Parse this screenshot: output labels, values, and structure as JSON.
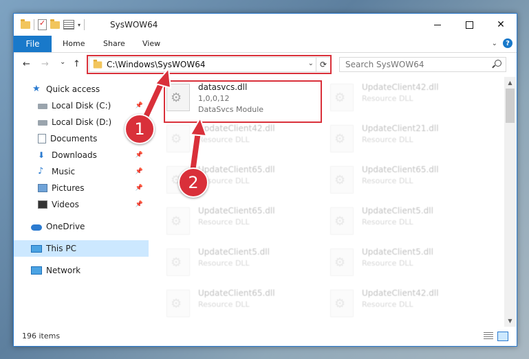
{
  "window": {
    "title": "SysWOW64",
    "controls": {
      "minimize": "",
      "maximize": "",
      "close": "✕"
    }
  },
  "ribbon": {
    "tabs": [
      "File",
      "Home",
      "Share",
      "View"
    ],
    "help": "?"
  },
  "navigation": {
    "back": "←",
    "forward": "→",
    "recent": "⌄",
    "up": "↑",
    "address": "C:\\Windows\\SysWOW64",
    "search_placeholder": "Search SysWOW64"
  },
  "sidebar": {
    "items": [
      {
        "label": "Quick access",
        "icon": "star-icon"
      },
      {
        "label": "Local Disk (C:)",
        "icon": "disk-icon",
        "pinned": true
      },
      {
        "label": "Local Disk (D:)",
        "icon": "disk-icon"
      },
      {
        "label": "Documents",
        "icon": "documents-icon",
        "pinned": true
      },
      {
        "label": "Downloads",
        "icon": "download-icon",
        "pinned": true
      },
      {
        "label": "Music",
        "icon": "music-icon",
        "pinned": true
      },
      {
        "label": "Pictures",
        "icon": "pictures-icon",
        "pinned": true
      },
      {
        "label": "Videos",
        "icon": "videos-icon",
        "pinned": true
      },
      {
        "label": "OneDrive",
        "icon": "cloud-icon"
      },
      {
        "label": "This PC",
        "icon": "computer-icon",
        "selected": true
      },
      {
        "label": "Network",
        "icon": "network-icon"
      }
    ]
  },
  "files": [
    {
      "name": "datasvcs.dll",
      "version": "1,0,0,12",
      "description": "DataSvcs Module",
      "highlighted": true
    },
    {
      "name": "UpdateClient42.dll",
      "description": "Resource DLL"
    },
    {
      "name": "UpdateClient42.dll",
      "description": "Resource DLL"
    },
    {
      "name": "UpdateClient21.dll",
      "description": "Resource DLL"
    },
    {
      "name": "UpdateClient65.dll",
      "description": "Resource DLL"
    },
    {
      "name": "UpdateClient65.dll",
      "description": "Resource DLL"
    },
    {
      "name": "UpdateClient65.dll",
      "description": "Resource DLL"
    },
    {
      "name": "UpdateClient5.dll",
      "description": "Resource DLL"
    },
    {
      "name": "UpdateClient5.dll",
      "description": "Resource DLL"
    },
    {
      "name": "UpdateClient5.dll",
      "description": "Resource DLL"
    },
    {
      "name": "UpdateClient65.dll",
      "description": "Resource DLL"
    },
    {
      "name": "UpdateClient42.dll",
      "description": "Resource DLL"
    }
  ],
  "status": {
    "item_count": "196 items"
  },
  "annotations": {
    "callout_1": "1",
    "callout_2": "2",
    "color": "#d9303a"
  },
  "colors": {
    "accent": "#1979ca",
    "highlight": "#d9303a",
    "selection": "#cce8ff"
  }
}
